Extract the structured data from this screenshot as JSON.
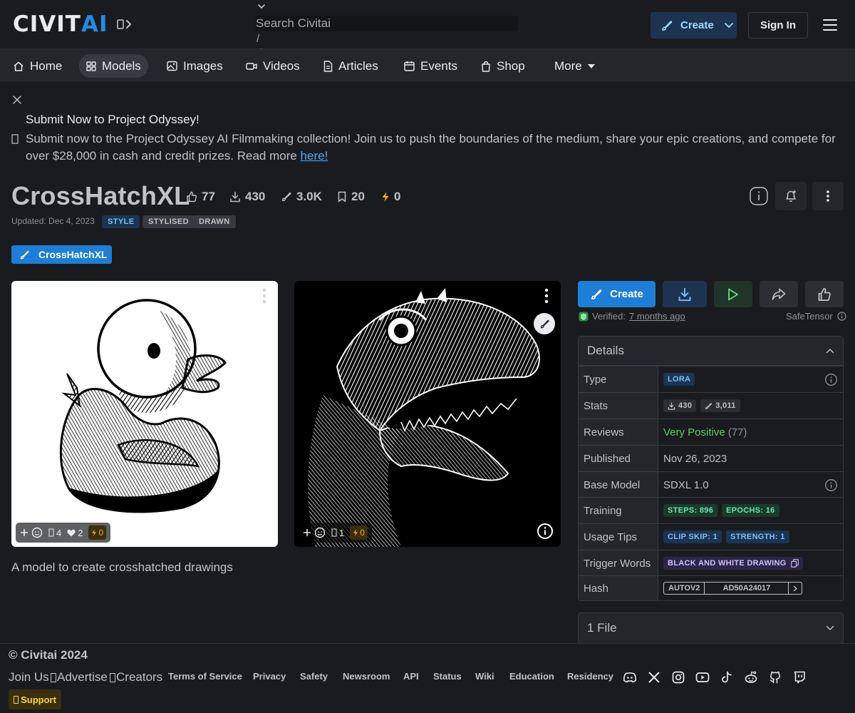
{
  "header": {
    "logo_main": "CIVIT",
    "logo_accent": "AI",
    "search_placeholder": "Search Civitai",
    "search_shortcut": "/",
    "create_label": "Create",
    "signin_label": "Sign In"
  },
  "nav": {
    "items": [
      {
        "label": "Home",
        "icon": "home-icon"
      },
      {
        "label": "Models",
        "icon": "grid-icon"
      },
      {
        "label": "Images",
        "icon": "photo-icon"
      },
      {
        "label": "Videos",
        "icon": "video-icon"
      },
      {
        "label": "Articles",
        "icon": "file-text-icon"
      },
      {
        "label": "Events",
        "icon": "calendar-icon"
      },
      {
        "label": "Shop",
        "icon": "shopping-bag-icon"
      }
    ],
    "more_label": "More"
  },
  "announcement": {
    "title": "Submit Now to Project Odyssey!",
    "text": "Submit now to the Project Odyssey AI Filmmaking collection! Join us to push the boundaries of the medium, share your epic creations, and compete for over $28,000 in cash and credit prizes. Read more ",
    "link_text": "here!"
  },
  "model": {
    "title": "CrossHatchXL",
    "stats": {
      "likes": "77",
      "downloads": "430",
      "generations": "3.0K",
      "bookmarks": "20",
      "buzz": "0"
    },
    "updated": "Updated: Dec 4, 2023",
    "tags": [
      "STYLE",
      "STYLISED",
      "DRAWN"
    ],
    "version_chip": "CrossHatchXL",
    "description": "A model to create crosshatched drawings"
  },
  "gallery": [
    {
      "subject": "duck",
      "comments": "4",
      "hearts": "2",
      "buzz": "0"
    },
    {
      "subject": "dinosaur",
      "comments": "1",
      "buzz": "0"
    }
  ],
  "actions": {
    "create_label": "Create",
    "verified_label": "Verified:",
    "verified_time": "7 months ago",
    "format": "SafeTensor"
  },
  "details": {
    "heading": "Details",
    "rows": {
      "type_k": "Type",
      "type_v": "LORA",
      "stats_k": "Stats",
      "stats_downloads": "430",
      "stats_generations": "3,011",
      "reviews_k": "Reviews",
      "reviews_v": "Very Positive",
      "reviews_count": "(77)",
      "published_k": "Published",
      "published_v": "Nov 26, 2023",
      "base_k": "Base Model",
      "base_v": "SDXL 1.0",
      "training_k": "Training",
      "training_steps": "STEPS: 896",
      "training_epochs": "EPOCHS: 16",
      "usage_k": "Usage Tips",
      "usage_clip": "CLIP SKIP: 1",
      "usage_strength": "STRENGTH: 1",
      "trigger_k": "Trigger Words",
      "trigger_v": "BLACK AND WHITE DRAWING",
      "hash_k": "Hash",
      "hash_type": "AUTOV2",
      "hash_v": "AD50A24017"
    }
  },
  "files_label": "1 File",
  "footer": {
    "copyright": "© Civitai 2024",
    "join_us": "Join Us",
    "advertise": "Advertise",
    "creators": "Creators",
    "links": [
      "Terms of Service",
      "Privacy",
      "Safety",
      "Newsroom",
      "API",
      "Status",
      "Wiki",
      "Education",
      "Residency"
    ],
    "support": "Support",
    "social_icons": [
      "discord-icon",
      "x-icon",
      "instagram-icon",
      "youtube-icon",
      "tiktok-icon",
      "reddit-icon",
      "github-icon",
      "twitch-icon"
    ]
  },
  "colors": {
    "background": "#1a1b1e",
    "surface": "#25262b",
    "accent": "#228be6",
    "create_button": "#1c7ed6",
    "buzz": "#fab005",
    "positive": "#51cf66"
  }
}
